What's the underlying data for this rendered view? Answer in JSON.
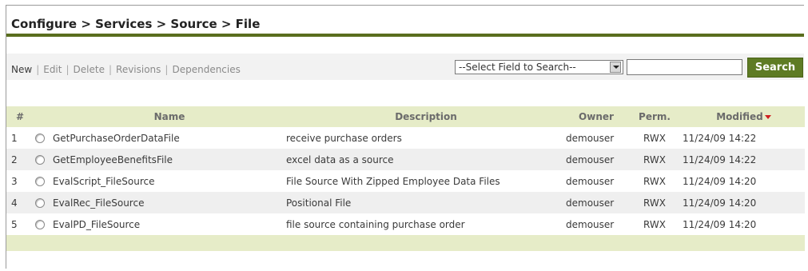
{
  "breadcrumb": {
    "text": "Configure > Services > Source > File"
  },
  "actions": [
    {
      "label": "New",
      "active": true
    },
    {
      "label": "Edit",
      "active": false
    },
    {
      "label": "Delete",
      "active": false
    },
    {
      "label": "Revisions",
      "active": false
    },
    {
      "label": "Dependencies",
      "active": false
    }
  ],
  "search": {
    "field_select": "--Select Field to Search--",
    "query_value": "",
    "button_label": "Search"
  },
  "table": {
    "columns": {
      "num": "#",
      "name": "Name",
      "description": "Description",
      "owner": "Owner",
      "perm": "Perm.",
      "modified": "Modified"
    },
    "rows": [
      {
        "num": "1",
        "name": "GetPurchaseOrderDataFile",
        "description": "receive purchase orders",
        "owner": "demouser",
        "perm": "RWX",
        "modified": "11/24/09 14:22"
      },
      {
        "num": "2",
        "name": "GetEmployeeBenefitsFile",
        "description": "excel data as a source",
        "owner": "demouser",
        "perm": "RWX",
        "modified": "11/24/09 14:22"
      },
      {
        "num": "3",
        "name": "EvalScript_FileSource",
        "description": "File Source With Zipped Employee Data Files",
        "owner": "demouser",
        "perm": "RWX",
        "modified": "11/24/09 14:20"
      },
      {
        "num": "4",
        "name": "EvalRec_FileSource",
        "description": "Positional File",
        "owner": "demouser",
        "perm": "RWX",
        "modified": "11/24/09 14:20"
      },
      {
        "num": "5",
        "name": "EvalPD_FileSource",
        "description": "file source containing purchase order",
        "owner": "demouser",
        "perm": "RWX",
        "modified": "11/24/09 14:20"
      }
    ]
  },
  "colors": {
    "accent": "#5a6e1e",
    "search_button": "#5e7b24",
    "header_bg": "#e6ecc8",
    "sort_arrow": "#d02020"
  }
}
